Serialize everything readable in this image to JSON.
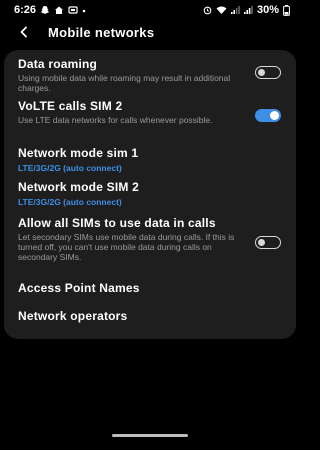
{
  "status_bar": {
    "time": "6:26",
    "battery": "30%"
  },
  "header": {
    "title": "Mobile networks"
  },
  "items": [
    {
      "title": "Data roaming",
      "desc": "Using mobile data while roaming may result in additional charges.",
      "toggle": "off"
    },
    {
      "title": "VoLTE calls SIM 2",
      "desc": "Use LTE data networks for calls whenever possible.",
      "toggle": "on"
    },
    {
      "title": "Network mode sim 1",
      "sub": "LTE/3G/2G (auto connect)"
    },
    {
      "title": "Network mode SIM 2",
      "sub": "LTE/3G/2G (auto connect)"
    },
    {
      "title": "Allow all SIMs to use data in calls",
      "desc": "Let secondary SIMs use mobile data during calls. If this is turned off, you can't use mobile data during calls on secondary SIMs.",
      "toggle": "off"
    },
    {
      "title": "Access Point Names"
    },
    {
      "title": "Network operators"
    }
  ],
  "colors": {
    "accent": "#3e8ee6",
    "card_bg": "#1e1e1e",
    "background": "#000000"
  }
}
